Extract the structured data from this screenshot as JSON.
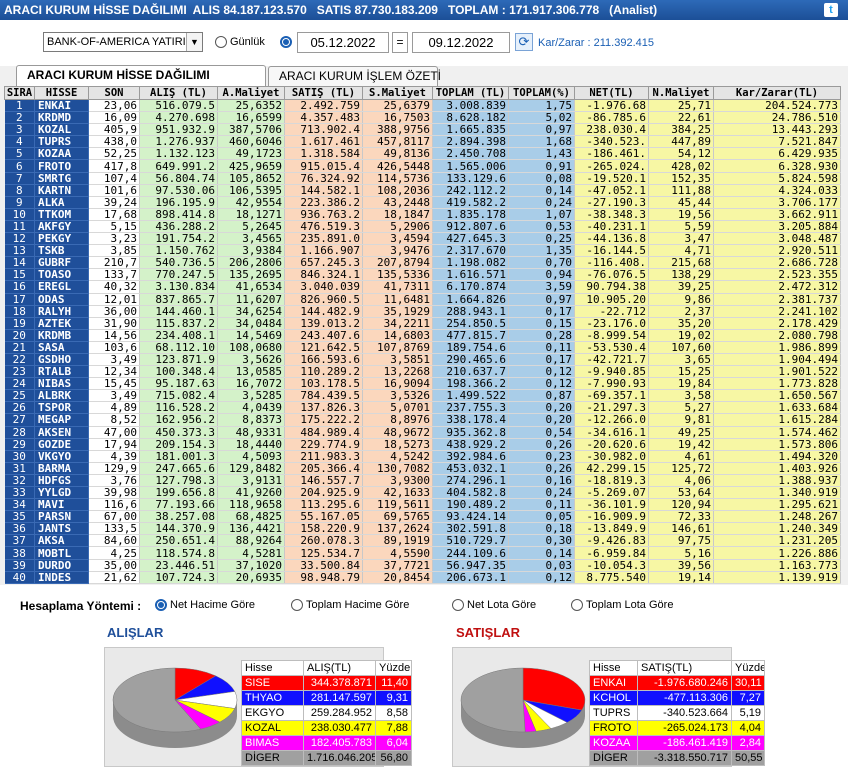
{
  "window": {
    "title_parts": [
      "ARACI KURUM HİSSE DAĞILIMI",
      "ALIS 84.187.123.570",
      "SATIS 87.730.183.209",
      "TOPLAM : 171.917.306.778",
      "(Analist)"
    ]
  },
  "filter": {
    "broker": "BANK-OF-AMERICA YATIRIM",
    "gunluk_label": "Günlük",
    "date_from": "05.12.2022",
    "eq": "=",
    "date_to": "09.12.2022",
    "karzarar": "Kar/Zarar : 211.392.415"
  },
  "tabs": [
    "ARACI KURUM HİSSE DAĞILIMI",
    "ARACI KURUM İŞLEM ÖZETİ"
  ],
  "table": {
    "headers": [
      "SIRA",
      "HİSSE",
      "SON",
      "ALIŞ (TL)",
      "A.Maliyet",
      "SATIŞ (TL)",
      "S.Maliyet",
      "TOPLAM (TL)",
      "TOPLAM(%)",
      "NET(TL)",
      "N.Maliyet",
      "Kar/Zarar(TL)"
    ],
    "rows": [
      [
        "1",
        "ENKAI",
        "23,06",
        "516.079.5",
        "25,6352",
        "2.492.759",
        "25,6379",
        "3.008.839",
        "1,75",
        "-1.976.68",
        "25,71",
        "204.524.773"
      ],
      [
        "2",
        "KRDMD",
        "16,09",
        "4.270.698",
        "16,6599",
        "4.357.483",
        "16,7503",
        "8.628.182",
        "5,02",
        "-86.785.6",
        "22,61",
        "24.786.510"
      ],
      [
        "3",
        "KOZAL",
        "405,9",
        "951.932.9",
        "387,5706",
        "713.902.4",
        "388,9756",
        "1.665.835",
        "0,97",
        "238.030.4",
        "384,25",
        "13.443.293"
      ],
      [
        "4",
        "TUPRS",
        "438,0",
        "1.276.937",
        "460,6046",
        "1.617.461",
        "457,8117",
        "2.894.398",
        "1,68",
        "-340.523.",
        "447,89",
        "7.521.847"
      ],
      [
        "5",
        "KOZAA",
        "52,25",
        "1.132.123",
        "49,1723",
        "1.318.584",
        "49,8136",
        "2.450.708",
        "1,43",
        "-186.461.",
        "54,12",
        "6.429.935"
      ],
      [
        "6",
        "FROTO",
        "417,8",
        "649.991.2",
        "425,9659",
        "915.015.4",
        "426,5448",
        "1.565.006",
        "0,91",
        "-265.024.",
        "428,02",
        "6.328.930"
      ],
      [
        "7",
        "SMRTG",
        "107,4",
        "56.804.74",
        "105,8652",
        "76.324.92",
        "114,5736",
        "133.129.6",
        "0,08",
        "-19.520.1",
        "152,35",
        "5.824.598"
      ],
      [
        "8",
        "KARTN",
        "101,6",
        "97.530.06",
        "106,5395",
        "144.582.1",
        "108,2036",
        "242.112.2",
        "0,14",
        "-47.052.1",
        "111,88",
        "4.324.033"
      ],
      [
        "9",
        "ALKA",
        "39,24",
        "196.195.9",
        "42,9554",
        "223.386.2",
        "43,2448",
        "419.582.2",
        "0,24",
        "-27.190.3",
        "45,44",
        "3.706.177"
      ],
      [
        "10",
        "TTKOM",
        "17,68",
        "898.414.8",
        "18,1271",
        "936.763.2",
        "18,1847",
        "1.835.178",
        "1,07",
        "-38.348.3",
        "19,56",
        "3.662.911"
      ],
      [
        "11",
        "AKFGY",
        "5,15",
        "436.288.2",
        "5,2645",
        "476.519.3",
        "5,2906",
        "912.807.6",
        "0,53",
        "-40.231.1",
        "5,59",
        "3.205.884"
      ],
      [
        "12",
        "PEKGY",
        "3,23",
        "191.754.2",
        "3,4565",
        "235.891.0",
        "3,4594",
        "427.645.3",
        "0,25",
        "-44.136.8",
        "3,47",
        "3.048.487"
      ],
      [
        "13",
        "TSKB",
        "3,85",
        "1.150.762",
        "3,9384",
        "1.166.907",
        "3,9476",
        "2.317.670",
        "1,35",
        "-16.144.5",
        "4,71",
        "2.920.511"
      ],
      [
        "14",
        "GUBRF",
        "210,7",
        "540.736.5",
        "206,2806",
        "657.245.3",
        "207,8794",
        "1.198.082",
        "0,70",
        "-116.408.",
        "215,68",
        "2.686.728"
      ],
      [
        "15",
        "TOASO",
        "133,7",
        "770.247.5",
        "135,2695",
        "846.324.1",
        "135,5336",
        "1.616.571",
        "0,94",
        "-76.076.5",
        "138,29",
        "2.523.355"
      ],
      [
        "16",
        "EREGL",
        "40,32",
        "3.130.834",
        "41,6534",
        "3.040.039",
        "41,7311",
        "6.170.874",
        "3,59",
        "90.794.38",
        "39,25",
        "2.472.312"
      ],
      [
        "17",
        "ODAS",
        "12,01",
        "837.865.7",
        "11,6207",
        "826.960.5",
        "11,6481",
        "1.664.826",
        "0,97",
        "10.905.20",
        "9,86",
        "2.381.737"
      ],
      [
        "18",
        "RALYH",
        "36,00",
        "144.460.1",
        "34,6254",
        "144.482.9",
        "35,1929",
        "288.943.1",
        "0,17",
        "-22.712",
        "2,37",
        "2.241.102"
      ],
      [
        "19",
        "AZTEK",
        "31,90",
        "115.837.2",
        "34,0484",
        "139.013.2",
        "34,2211",
        "254.850.5",
        "0,15",
        "-23.176.0",
        "35,20",
        "2.178.429"
      ],
      [
        "20",
        "KRDMB",
        "14,56",
        "234.408.1",
        "14,5469",
        "243.407.6",
        "14,6803",
        "477.815.7",
        "0,28",
        "-8.999.54",
        "19,02",
        "2.080.798"
      ],
      [
        "21",
        "SASA",
        "103,6",
        "68.112.10",
        "108,0680",
        "121.642.5",
        "107,8769",
        "189.754.6",
        "0,11",
        "-53.530.4",
        "107,60",
        "1.986.899"
      ],
      [
        "22",
        "GSDHO",
        "3,49",
        "123.871.9",
        "3,5626",
        "166.593.6",
        "3,5851",
        "290.465.6",
        "0,17",
        "-42.721.7",
        "3,65",
        "1.904.494"
      ],
      [
        "23",
        "RTALB",
        "12,34",
        "100.348.4",
        "13,0585",
        "110.289.2",
        "13,2268",
        "210.637.7",
        "0,12",
        "-9.940.85",
        "15,25",
        "1.901.522"
      ],
      [
        "24",
        "NIBAS",
        "15,45",
        "95.187.63",
        "16,7072",
        "103.178.5",
        "16,9094",
        "198.366.2",
        "0,12",
        "-7.990.93",
        "19,84",
        "1.773.828"
      ],
      [
        "25",
        "ALBRK",
        "3,49",
        "715.082.4",
        "3,5285",
        "784.439.5",
        "3,5326",
        "1.499.522",
        "0,87",
        "-69.357.1",
        "3,58",
        "1.650.567"
      ],
      [
        "26",
        "TSPOR",
        "4,89",
        "116.528.2",
        "4,0439",
        "137.826.3",
        "5,0701",
        "237.755.3",
        "0,20",
        "-21.297.3",
        "5,27",
        "1.633.684"
      ],
      [
        "27",
        "MEGAP",
        "8,52",
        "162.956.2",
        "8,8373",
        "175.222.2",
        "8,8976",
        "338.178.4",
        "0,20",
        "-12.266.0",
        "9,81",
        "1.615.284"
      ],
      [
        "28",
        "AKSEN",
        "47,00",
        "450.373.3",
        "48,9331",
        "484.989.4",
        "48,9672",
        "935.362.8",
        "0,54",
        "-34.616.1",
        "49,25",
        "1.574.462"
      ],
      [
        "29",
        "GOZDE",
        "17,94",
        "209.154.3",
        "18,4440",
        "229.774.9",
        "18,5273",
        "438.929.2",
        "0,26",
        "-20.620.6",
        "19,42",
        "1.573.806"
      ],
      [
        "30",
        "VKGYO",
        "4,39",
        "181.001.3",
        "4,5093",
        "211.983.3",
        "4,5242",
        "392.984.6",
        "0,23",
        "-30.982.0",
        "4,61",
        "1.494.320"
      ],
      [
        "31",
        "BARMA",
        "129,9",
        "247.665.6",
        "129,8482",
        "205.366.4",
        "130,7082",
        "453.032.1",
        "0,26",
        "42.299.15",
        "125,72",
        "1.403.926"
      ],
      [
        "32",
        "HDFGS",
        "3,76",
        "127.798.3",
        "3,9131",
        "146.557.7",
        "3,9300",
        "274.296.1",
        "0,16",
        "-18.819.3",
        "4,06",
        "1.388.937"
      ],
      [
        "33",
        "YYLGD",
        "39,98",
        "199.656.8",
        "41,9260",
        "204.925.9",
        "42,1633",
        "404.582.8",
        "0,24",
        "-5.269.07",
        "53,64",
        "1.340.919"
      ],
      [
        "34",
        "MAVI",
        "116,6",
        "77.193.66",
        "118,9658",
        "113.295.6",
        "119,5611",
        "190.489.2",
        "0,11",
        "-36.101.9",
        "120,94",
        "1.295.621"
      ],
      [
        "35",
        "PARSN",
        "67,00",
        "38.257.08",
        "68,4825",
        "55.167.05",
        "69,5765",
        "93.424.14",
        "0,05",
        "-16.909.9",
        "72,33",
        "1.248.267"
      ],
      [
        "36",
        "JANTS",
        "133,5",
        "144.370.9",
        "136,4421",
        "158.220.9",
        "137,2624",
        "302.591.8",
        "0,18",
        "-13.849.9",
        "146,61",
        "1.240.349"
      ],
      [
        "37",
        "AKSA",
        "84,60",
        "250.651.4",
        "88,9264",
        "260.078.3",
        "89,1919",
        "510.729.7",
        "0,30",
        "-9.426.83",
        "97,75",
        "1.231.205"
      ],
      [
        "38",
        "MOBTL",
        "4,25",
        "118.574.8",
        "4,5281",
        "125.534.7",
        "4,5590",
        "244.109.6",
        "0,14",
        "-6.959.84",
        "5,16",
        "1.226.886"
      ],
      [
        "39",
        "DURDO",
        "35,00",
        "23.446.51",
        "37,1020",
        "33.500.84",
        "37,7721",
        "56.947.35",
        "0,03",
        "-10.054.3",
        "39,56",
        "1.163.773"
      ],
      [
        "40",
        "INDES",
        "21,62",
        "107.724.3",
        "20,6935",
        "98.948.79",
        "20,8454",
        "206.673.1",
        "0,12",
        "8.775.540",
        "19,14",
        "1.139.919"
      ]
    ]
  },
  "bottom": {
    "method_label": "Hesaplama Yöntemi :",
    "methods": [
      "Net Hacime Göre",
      "Toplam Hacime Göre",
      "Net Lota Göre",
      "Toplam Lota Göre"
    ],
    "alislar": {
      "title": "ALIŞLAR",
      "headers": [
        "Hisse",
        "ALIŞ(TL)",
        "Yüzde"
      ],
      "rows": [
        {
          "name": "SISE",
          "value": "344.378.871",
          "pct": "11,40",
          "color": "#ff0000",
          "text": "#ffffff"
        },
        {
          "name": "THYAO",
          "value": "281.147.597",
          "pct": "9,31",
          "color": "#1010ff",
          "text": "#ffffff"
        },
        {
          "name": "EKGYO",
          "value": "259.284.952",
          "pct": "8,58",
          "color": "#ffffff",
          "text": "#000000"
        },
        {
          "name": "KOZAL",
          "value": "238.030.477",
          "pct": "7,88",
          "color": "#ffff00",
          "text": "#000000"
        },
        {
          "name": "BIMAS",
          "value": "182.405.783",
          "pct": "6,04",
          "color": "#ff00ff",
          "text": "#ffffff"
        },
        {
          "name": "DİGER",
          "value": "1.716.046.205",
          "pct": "56,80",
          "color": "#a0a0a0",
          "text": "#000000"
        }
      ]
    },
    "satislar": {
      "title": "SATIŞLAR",
      "headers": [
        "Hisse",
        "SATIŞ(TL)",
        "Yüzde"
      ],
      "rows": [
        {
          "name": "ENKAI",
          "value": "-1.976.680.246",
          "pct": "30,11",
          "color": "#ff0000",
          "text": "#ffffff"
        },
        {
          "name": "KCHOL",
          "value": "-477.113.306",
          "pct": "7,27",
          "color": "#1010ff",
          "text": "#ffffff"
        },
        {
          "name": "TUPRS",
          "value": "-340.523.664",
          "pct": "5,19",
          "color": "#ffffff",
          "text": "#000000"
        },
        {
          "name": "FROTO",
          "value": "-265.024.173",
          "pct": "4,04",
          "color": "#ffff00",
          "text": "#000000"
        },
        {
          "name": "KOZAA",
          "value": "-186.461.419",
          "pct": "2,84",
          "color": "#ff00ff",
          "text": "#ffffff"
        },
        {
          "name": "DİGER",
          "value": "-3.318.550.717",
          "pct": "50,55",
          "color": "#a0a0a0",
          "text": "#000000"
        }
      ]
    }
  }
}
